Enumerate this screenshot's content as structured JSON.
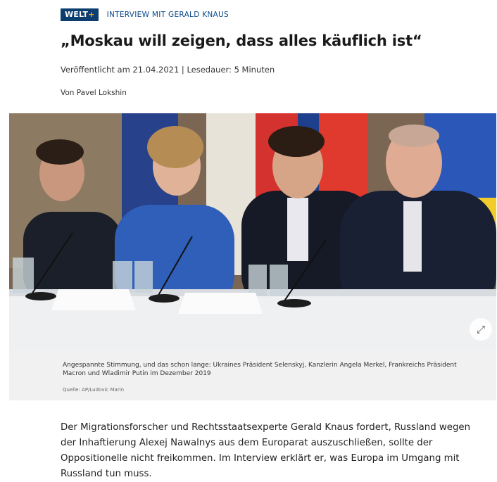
{
  "brand": {
    "name": "WELT",
    "plus": "+"
  },
  "kicker": "INTERVIEW MIT GERALD KNAUS",
  "headline": "„Moskau will zeigen, dass alles käuflich ist“",
  "meta": "Veröffentlicht am 21.04.2021 | Lesedauer: 5 Minuten",
  "author": "Von Pavel Lokshin",
  "photo": {
    "expand_icon": "expand-icon",
    "caption": "Angespannte Stimmung, und das schon lange: Ukraines Präsident Selenskyj, Kanzlerin Angela Merkel, Frankreichs Präsident Macron und Wladimir Putin im Dezember 2019",
    "source": "Quelle: AP/Ludovic Marin"
  },
  "lead": "Der Migrationsforscher und Rechtsstaatsexperte Gerald Knaus fordert, Russland wegen der Inhaftierung Alexej Nawalnys aus dem Europarat auszuschließen, sollte der Oppositionelle nicht freikommen. Im Interview erklärt er, was Europa im Umgang mit Russland tun muss."
}
